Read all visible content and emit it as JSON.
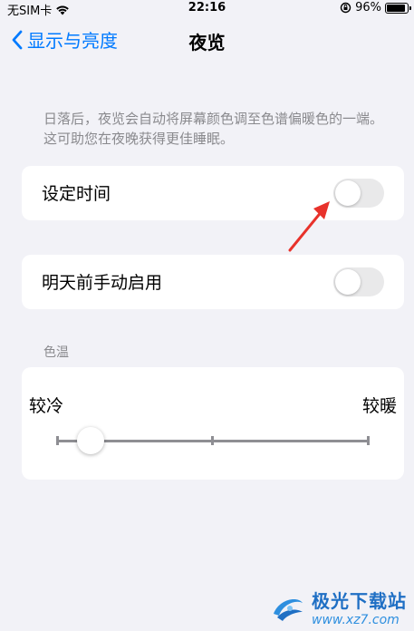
{
  "status_bar": {
    "carrier": "无SIM卡",
    "time": "22:16",
    "battery_percent": "96%",
    "battery_level": 0.96
  },
  "nav": {
    "back_label": "显示与亮度",
    "title": "夜览"
  },
  "description": "日落后，夜览会自动将屏幕颜色调至色谱偏暖色的一端。这可助您在夜晚获得更佳睡眠。",
  "settings": {
    "scheduled": {
      "label": "设定时间",
      "on": false
    },
    "manual": {
      "label": "明天前手动启用",
      "on": false
    }
  },
  "color_temp": {
    "header": "色温",
    "cooler_label": "较冷",
    "warmer_label": "较暖",
    "slider_value": 0.11
  },
  "watermark": {
    "title": "极光下载站",
    "url": "www.xz7.com"
  },
  "colors": {
    "accent": "#007aff",
    "annotation": "#e8322b"
  }
}
